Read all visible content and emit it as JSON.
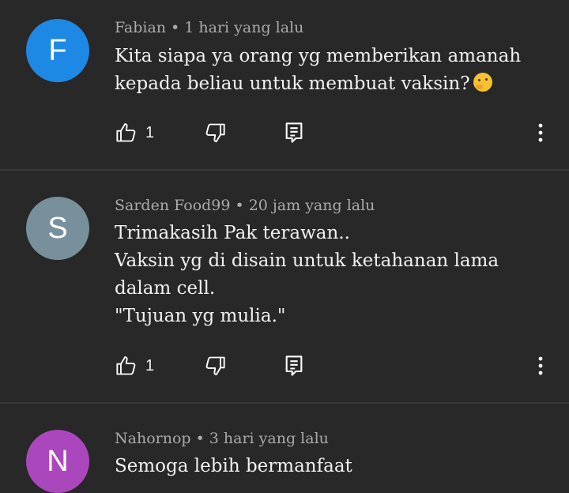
{
  "comments": [
    {
      "avatar_letter": "F",
      "avatar_color": "#1e88e5",
      "author": "Fabian",
      "separator": "•",
      "time": "1 hari yang lalu",
      "text": "Kita siapa ya orang yg memberikan amanah kepada beliau untuk membuat vaksin?",
      "emoji": "thinking-face-emoji",
      "like_count": "1"
    },
    {
      "avatar_letter": "S",
      "avatar_color": "#78909c",
      "author": "Sarden Food99",
      "separator": "•",
      "time": "20 jam yang lalu",
      "text": "Trimakasih Pak terawan..\n Vaksin yg di disain untuk ketahanan lama dalam cell.\n\"Tujuan yg mulia.\"",
      "like_count": "1"
    },
    {
      "avatar_letter": "N",
      "avatar_color": "#ab47bc",
      "author": "Nahornop",
      "separator": "•",
      "time": "3 hari yang lalu",
      "text": "Semoga lebih bermanfaat"
    }
  ],
  "icons": {
    "like": "thumbs-up-icon",
    "dislike": "thumbs-down-icon",
    "reply": "reply-icon",
    "more": "more-vert-icon"
  }
}
